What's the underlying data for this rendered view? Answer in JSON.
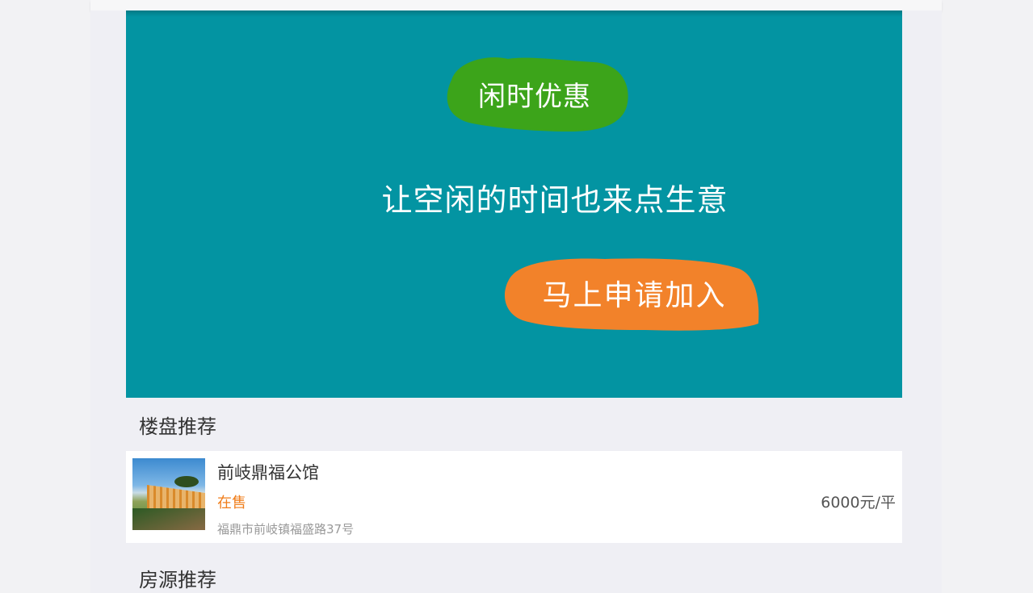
{
  "banner": {
    "background_color": "#0394a2",
    "promo_label": "闲时优惠",
    "promo_color": "#3ca41a",
    "tagline": "让空闲的时间也来点生意",
    "join_button_label": "马上申请加入",
    "join_button_color": "#f2822a"
  },
  "sections": {
    "buildings_title": "楼盘推荐",
    "listings_title": "房源推荐"
  },
  "building_card": {
    "name": "前岐鼎福公馆",
    "status": "在售",
    "status_color": "#f07d1a",
    "address": "福鼎市前岐镇福盛路37号",
    "price": "6000元/平"
  }
}
